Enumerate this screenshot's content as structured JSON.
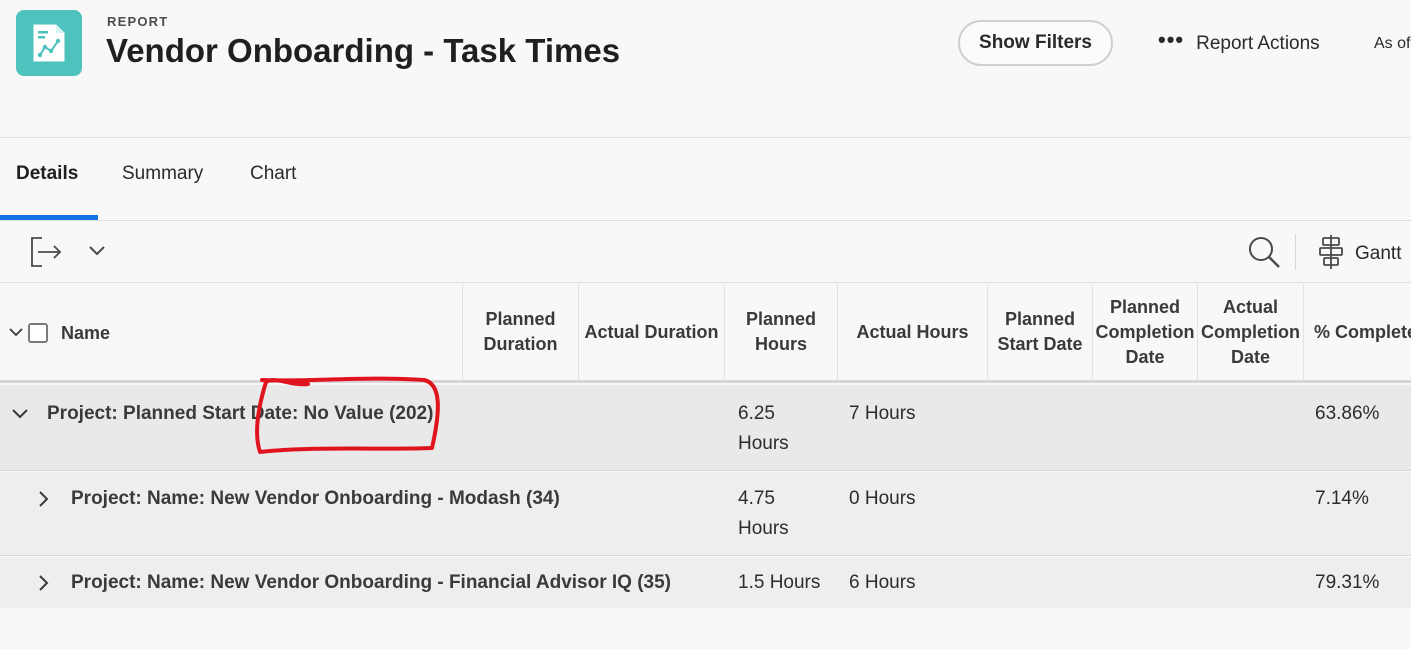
{
  "header": {
    "report_label": "REPORT",
    "title": "Vendor Onboarding - Task Times",
    "show_filters": "Show Filters",
    "report_actions": "Report Actions",
    "as_of": "As of"
  },
  "tabs": [
    {
      "label": "Details",
      "active": true
    },
    {
      "label": "Summary",
      "active": false
    },
    {
      "label": "Chart",
      "active": false
    }
  ],
  "toolbar": {
    "gantt_label": "Gantt"
  },
  "columns": {
    "name": "Name",
    "planned_duration": "Planned Duration",
    "actual_duration": "Actual Duration",
    "planned_hours": "Planned Hours",
    "actual_hours": "Actual Hours",
    "planned_start_date": "Planned Start Date",
    "planned_completion_date": "Planned Completion Date",
    "actual_completion_date": "Actual Completion Date",
    "percent_complete": "% Complete"
  },
  "rows": [
    {
      "label": "Project: Planned Start Date: No Value (202)",
      "planned_hours": "6.25 Hours",
      "actual_hours": "7 Hours",
      "percent_complete": "63.86%"
    },
    {
      "label": "Project: Name: New Vendor Onboarding - Modash (34)",
      "planned_hours": "4.75 Hours",
      "actual_hours": "0 Hours",
      "percent_complete": "7.14%"
    },
    {
      "label": "Project: Name: New Vendor Onboarding - Financial Advisor IQ (35)",
      "planned_hours": "1.5 Hours",
      "actual_hours": "6 Hours",
      "percent_complete": "79.31%"
    }
  ],
  "colors": {
    "icon_bg": "#4ec2bd",
    "tab_accent": "#1473e6",
    "annotation": "#e0141e"
  }
}
